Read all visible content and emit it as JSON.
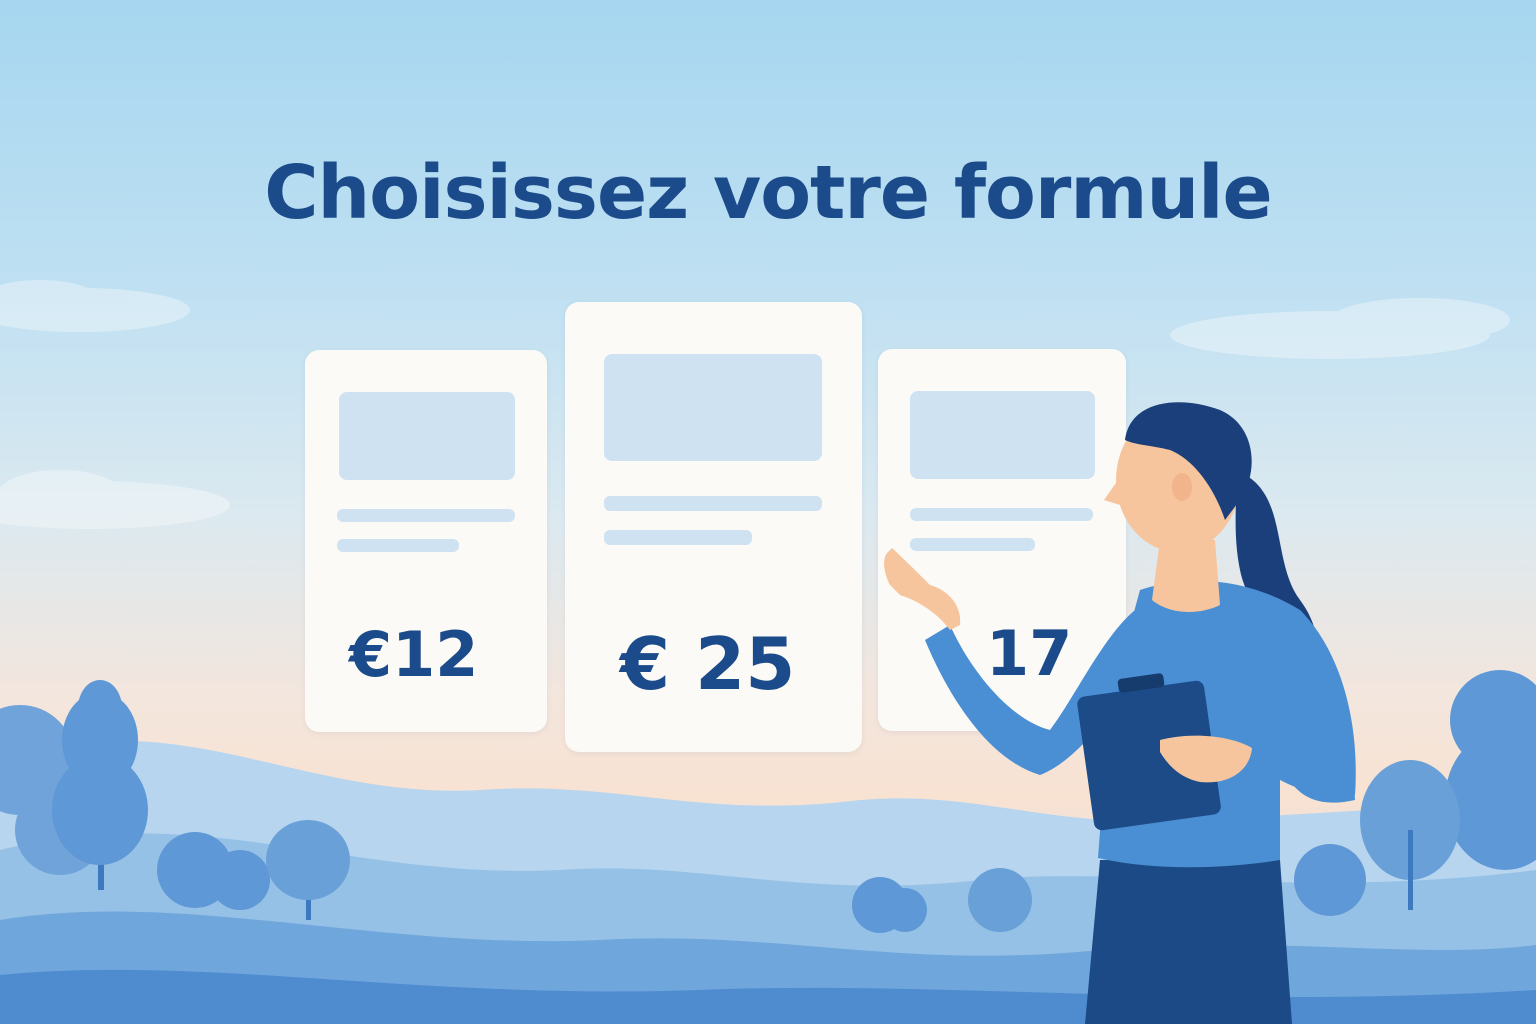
{
  "header": {
    "title": "Choisissez votre formule"
  },
  "plans": [
    {
      "price": "€12"
    },
    {
      "price": "€ 25"
    },
    {
      "price": "17"
    }
  ],
  "colors": {
    "title": "#1b4b8a",
    "card_background": "#fbfaf6",
    "card_placeholder": "#cfe2f2",
    "shirt": "#4a8ed3",
    "pants": "#1c4a86",
    "hair": "#1b3f7a",
    "skin": "#f6c59e",
    "clipboard": "#1d4b88"
  },
  "icons": [
    "clipboard-icon"
  ]
}
